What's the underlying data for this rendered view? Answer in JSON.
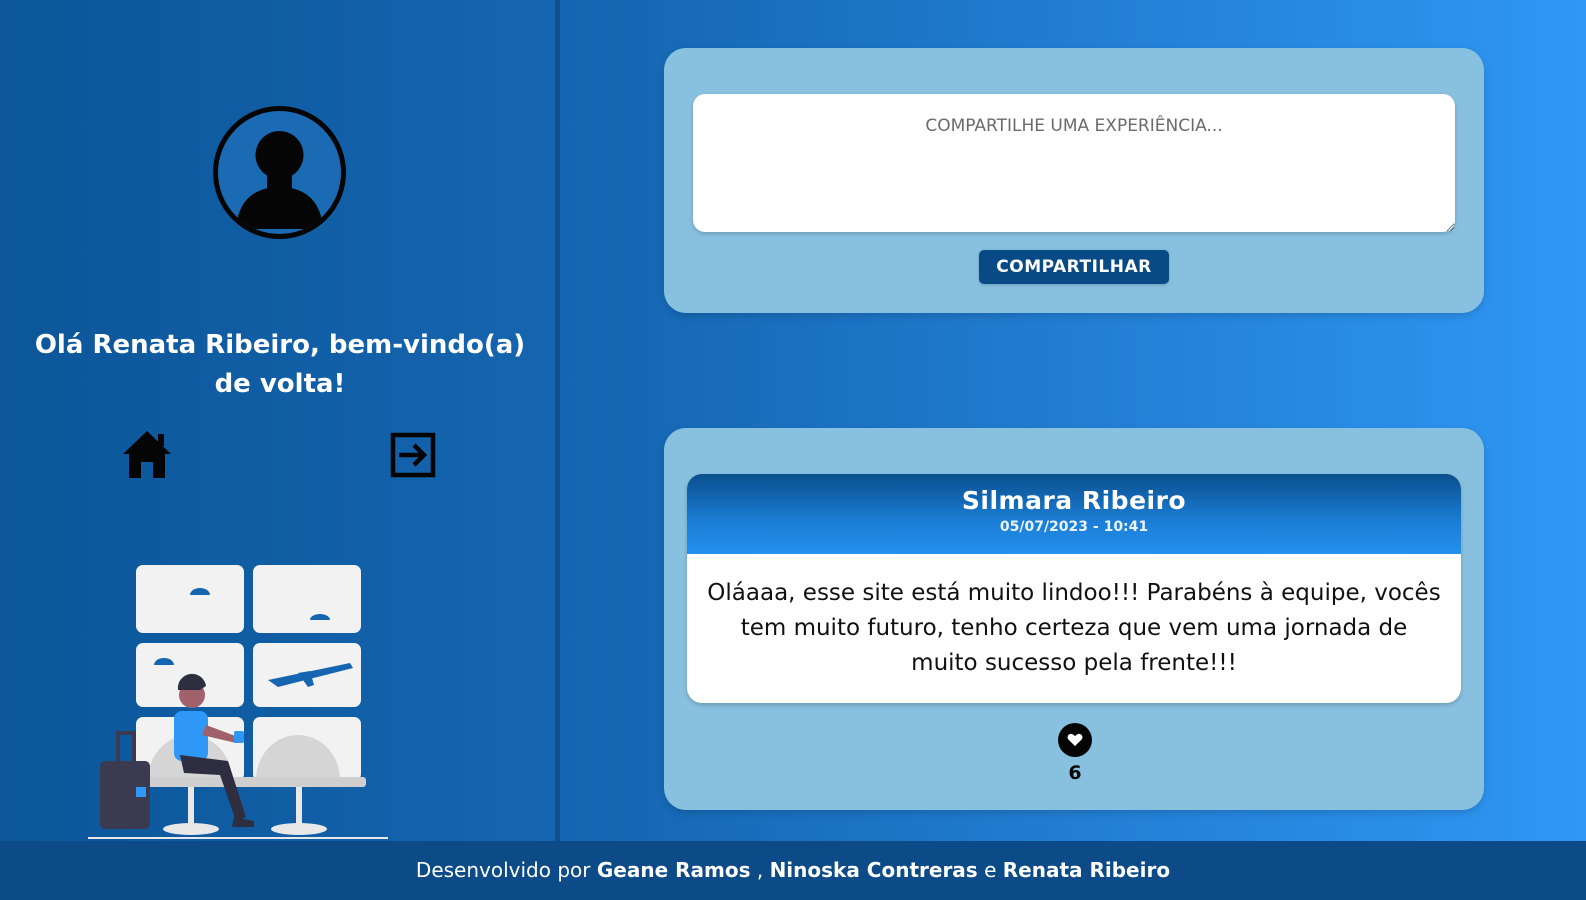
{
  "sidebar": {
    "greeting": "Olá Renata Ribeiro, bem-vindo(a) de volta!",
    "avatar_icon": "user-avatar-icon",
    "home_icon": "home-icon",
    "logout_icon": "logout-icon"
  },
  "composer": {
    "placeholder": "COMPARTILHE UMA EXPERIÊNCIA...",
    "share_label": "COMPARTILHAR"
  },
  "feed": {
    "posts": [
      {
        "author": "Silmara Ribeiro",
        "date": "05/07/2023 - 10:41",
        "text": "Oláaaa, esse site está muito lindoo!!! Parabéns à equipe, vocês tem muito futuro, tenho certeza que vem uma jornada de muito sucesso pela frente!!!",
        "likes": "6",
        "like_icon": "heart-icon"
      }
    ]
  },
  "footer": {
    "prefix": "Desenvolvido por",
    "dev1": "Geane Ramos",
    "sep1": ",",
    "dev2": "Ninoska Contreras",
    "sep2": "e",
    "dev3": "Renata Ribeiro"
  },
  "colors": {
    "accent_dark": "#074a85",
    "panel": "#88c1e0",
    "footer": "#0c4b87"
  }
}
